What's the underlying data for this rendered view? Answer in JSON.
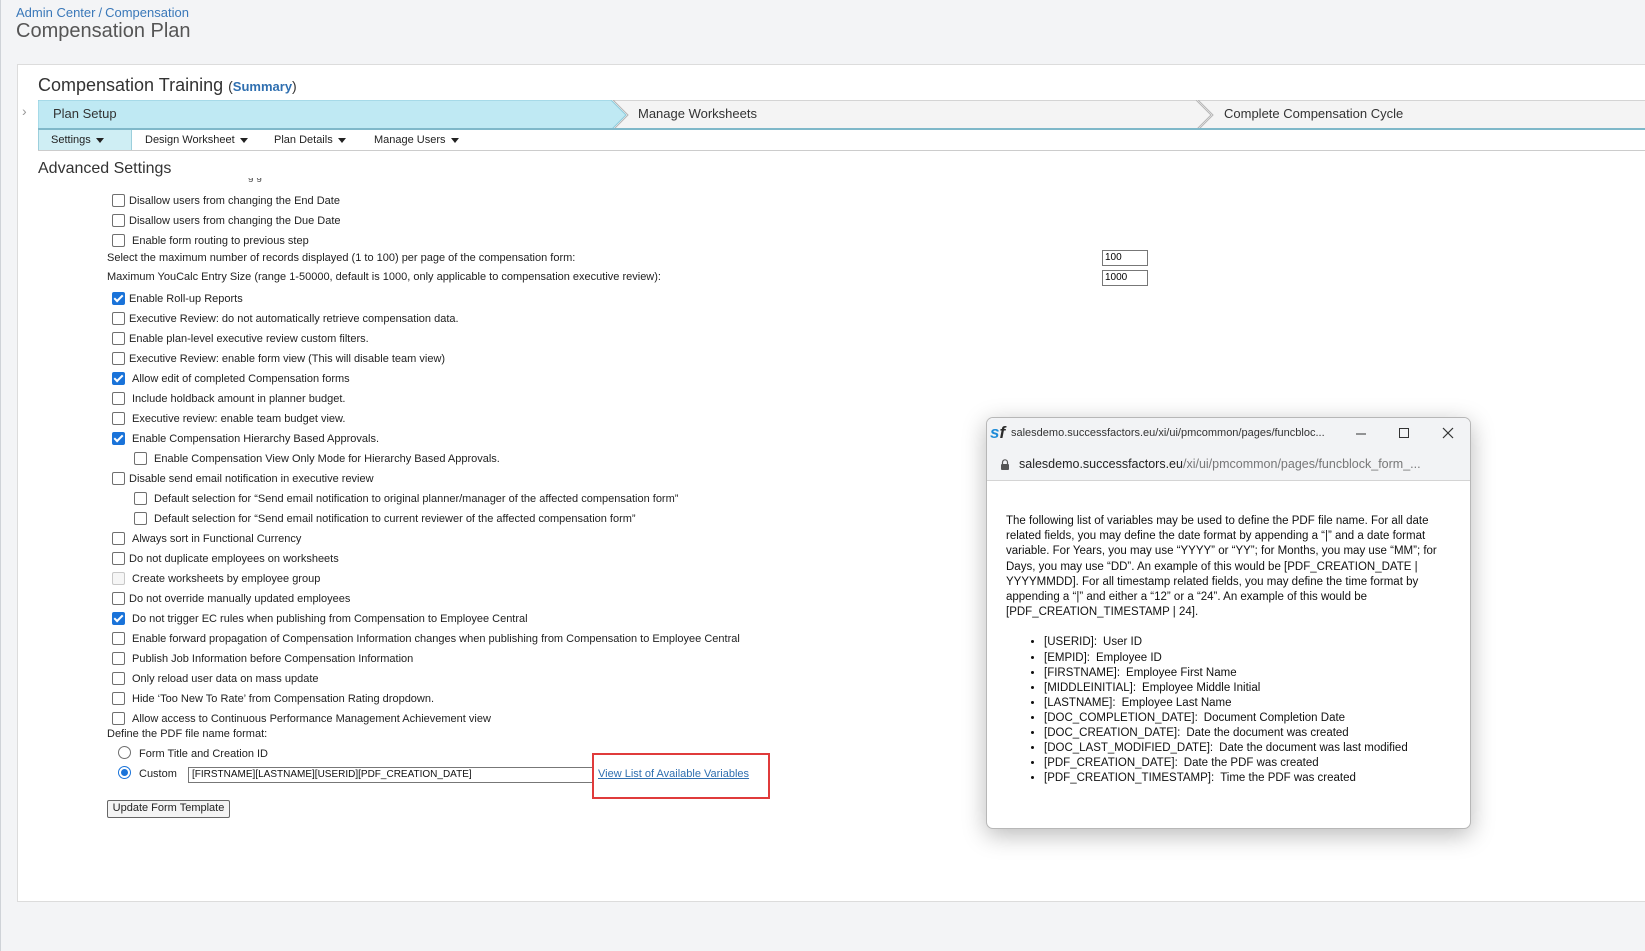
{
  "breadcrumb": {
    "items": [
      "Admin Center",
      "Compensation"
    ],
    "separator": "/"
  },
  "page_title": "Compensation Plan",
  "plan": {
    "title": "Compensation Training",
    "summary_link": "Summary"
  },
  "steps": [
    "Plan Setup",
    "Manage Worksheets",
    "Complete Compensation Cycle"
  ],
  "subtabs": [
    "Settings",
    "Design Worksheet",
    "Plan Details",
    "Manage Users"
  ],
  "section_title": "Advanced Settings",
  "settings": {
    "disallow_end_date": {
      "label": "Disallow users from changing the End Date",
      "checked": false
    },
    "disallow_due_date": {
      "label": "Disallow users from changing the Due Date",
      "checked": false
    },
    "enable_form_routing": {
      "label": "Enable form routing to previous step",
      "checked": false
    },
    "max_records_label": "Select the maximum number of records displayed (1 to 100) per page of the compensation form:",
    "max_records_value": "100",
    "max_youcalc_label": "Maximum YouCalc Entry Size (range 1-50000, default is 1000, only applicable to compensation executive review):",
    "max_youcalc_value": "1000",
    "options": [
      {
        "label": "Enable Roll-up Reports",
        "checked": true
      },
      {
        "label": "Executive Review: do not automatically retrieve compensation data.",
        "checked": false
      },
      {
        "label": "Enable plan-level executive review custom filters.",
        "checked": false
      },
      {
        "label": "Executive Review: enable form view (This will disable team view)",
        "checked": false
      },
      {
        "label": "Allow edit of completed Compensation forms",
        "checked": true
      },
      {
        "label": "Include holdback amount in planner budget.",
        "checked": false
      },
      {
        "label": "Executive review: enable team budget view.",
        "checked": false
      },
      {
        "label": "Enable Compensation Hierarchy Based Approvals.",
        "checked": true
      },
      {
        "label": "Enable Compensation View Only Mode for Hierarchy Based Approvals.",
        "checked": false
      },
      {
        "label": "Disable send email notification in executive review",
        "checked": false
      },
      {
        "label": "Default selection for “Send email notification to original planner/manager of the affected compensation form”",
        "checked": false
      },
      {
        "label": "Default selection for “Send email notification to current reviewer of the affected compensation form”",
        "checked": false
      },
      {
        "label": "Always sort in Functional Currency",
        "checked": false
      },
      {
        "label": "Do not duplicate employees on worksheets",
        "checked": false
      },
      {
        "label": "Create worksheets by employee group",
        "checked": false,
        "disabled": true
      },
      {
        "label": "Do not override manually updated employees",
        "checked": false
      },
      {
        "label": "Do not trigger EC rules when publishing from Compensation to Employee Central",
        "checked": true
      },
      {
        "label": "Enable forward propagation of Compensation Information changes when publishing from Compensation to Employee Central",
        "checked": false
      },
      {
        "label": "Publish Job Information before Compensation Information",
        "checked": false
      },
      {
        "label": "Only reload user data on mass update",
        "checked": false
      },
      {
        "label": "Hide ‘Too New To Rate’ from Compensation Rating dropdown.",
        "checked": false
      },
      {
        "label": "Allow access to Continuous Performance Management Achievement view",
        "checked": false
      }
    ]
  },
  "pdf_format": {
    "label": "Define the PDF file name format:",
    "option_title": "Form Title and Creation ID",
    "option_custom": "Custom",
    "selected": "Custom",
    "custom_value": "[FIRSTNAME][LASTNAME][USERID][PDF_CREATION_DATE]",
    "view_variables_link": "View List of Available Variables"
  },
  "update_button": "Update Form Template",
  "popup": {
    "title": "salesdemo.successfactors.eu/xi/ui/pmcommon/pages/funcbloc...",
    "url_host": "salesdemo.successfactors.eu",
    "url_path": "/xi/ui/pmcommon/pages/funcblock_form_...",
    "intro": "The following list of variables may be used to define the PDF file name. For all date related fields, you may define the date format by appending a “|” and a date format variable. For Years, you may use “YYYY” or “YY”; for Months, you may use “MM”; for Days, you may use “DD”. An example of this would be [PDF_CREATION_DATE | YYYYMMDD]. For all timestamp related fields, you may define the time format by appending a “|” and either a “12” or a “24”. An example of this would be [PDF_CREATION_TIMESTAMP | 24].",
    "variables": [
      {
        "name": "[USERID]:",
        "desc": "User ID"
      },
      {
        "name": "[EMPID]:",
        "desc": "Employee ID"
      },
      {
        "name": "[FIRSTNAME]:",
        "desc": "Employee First Name"
      },
      {
        "name": "[MIDDLEINITIAL]:",
        "desc": "Employee Middle Initial"
      },
      {
        "name": "[LASTNAME]:",
        "desc": "Employee Last Name"
      },
      {
        "name": "[DOC_COMPLETION_DATE]:",
        "desc": "Document Completion Date"
      },
      {
        "name": "[DOC_CREATION_DATE]:",
        "desc": "Date the document was created"
      },
      {
        "name": "[DOC_LAST_MODIFIED_DATE]:",
        "desc": "Date the document was last modified"
      },
      {
        "name": "[PDF_CREATION_DATE]:",
        "desc": "Date the PDF was created"
      },
      {
        "name": "[PDF_CREATION_TIMESTAMP]:",
        "desc": "Time the PDF was created"
      }
    ]
  },
  "colors": {
    "accent": "#1a73d9",
    "step_active": "#bfe9f3",
    "link": "#2f6fb0",
    "highlight": "#e03b3b"
  }
}
